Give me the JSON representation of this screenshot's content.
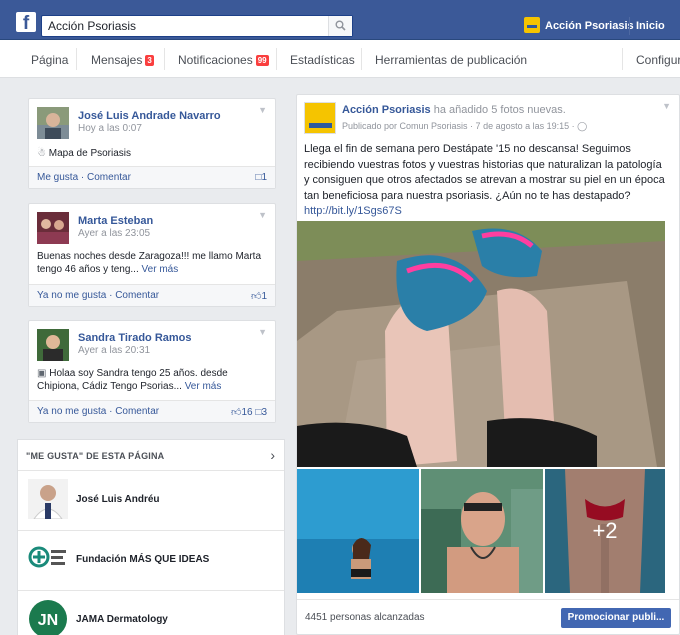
{
  "topbar": {
    "search_value": "Acción Psoriasis",
    "page_name": "Acción Psoriasis",
    "home_label": "Inicio"
  },
  "pagenav": {
    "items": [
      {
        "label": "Página"
      },
      {
        "label": "Mensajes",
        "badge": "3"
      },
      {
        "label": "Notificaciones",
        "badge": "99"
      },
      {
        "label": "Estadísticas"
      },
      {
        "label": "Herramientas de publicación"
      },
      {
        "label": "Configura"
      }
    ]
  },
  "sidebar_posts": [
    {
      "name": "José Luis Andrade Navarro",
      "time": "Hoy a las 0:07",
      "body": "Mapa de Psoriasis",
      "actions": "Me gusta · Comentar",
      "count": "1"
    },
    {
      "name": "Marta Esteban",
      "time": "Ayer a las 23:05",
      "body": "Buenas noches desde Zaragoza!!! me llamo Marta tengo 46 años y teng...",
      "more": "Ver más",
      "actions": "Ya no me gusta · Comentar",
      "count": "1"
    },
    {
      "name": "Sandra Tirado Ramos",
      "time": "Ayer a las 20:31",
      "body": "Holaa soy Sandra tengo 25 años. desde Chipiona, Cádiz Tengo Psorias...",
      "more": "Ver más",
      "actions": "Ya no me gusta · Comentar",
      "count_likes": "16",
      "count_comments": "3"
    }
  ],
  "page_likes": {
    "header": "\"ME GUSTA\" DE ESTA PÁGINA",
    "items": [
      {
        "name": "José Luis Andréu"
      },
      {
        "name": "Fundación MÁS QUE IDEAS"
      },
      {
        "name": "JAMA Dermatology"
      }
    ]
  },
  "post": {
    "author": "Acción Psoriasis",
    "action": "ha añadido 5 fotos nuevas.",
    "meta": "Publicado por Comun Psoriasis · 7 de agosto a las 19:15 ·",
    "text": "Llega el fin de semana pero Destápate '15 no descansa! Seguimos recibiendo vuestras fotos y vuestras historias que naturalizan la patología y consiguen que otros afectados se atrevan a mostrar su piel en un época tan beneficiosa para nuestra psoriasis. ¿Aún no te has destapado?",
    "link": "http://bit.ly/1Sgs67S",
    "more_photos": "+2",
    "reach": "4451 personas alcanzadas",
    "promote": "Promocionar publi..."
  },
  "colors": {
    "brand_blue": "#3b5998",
    "badge_red": "#fa3e3e",
    "link_blue": "#365899",
    "logo_yellow": "#f5c400"
  }
}
